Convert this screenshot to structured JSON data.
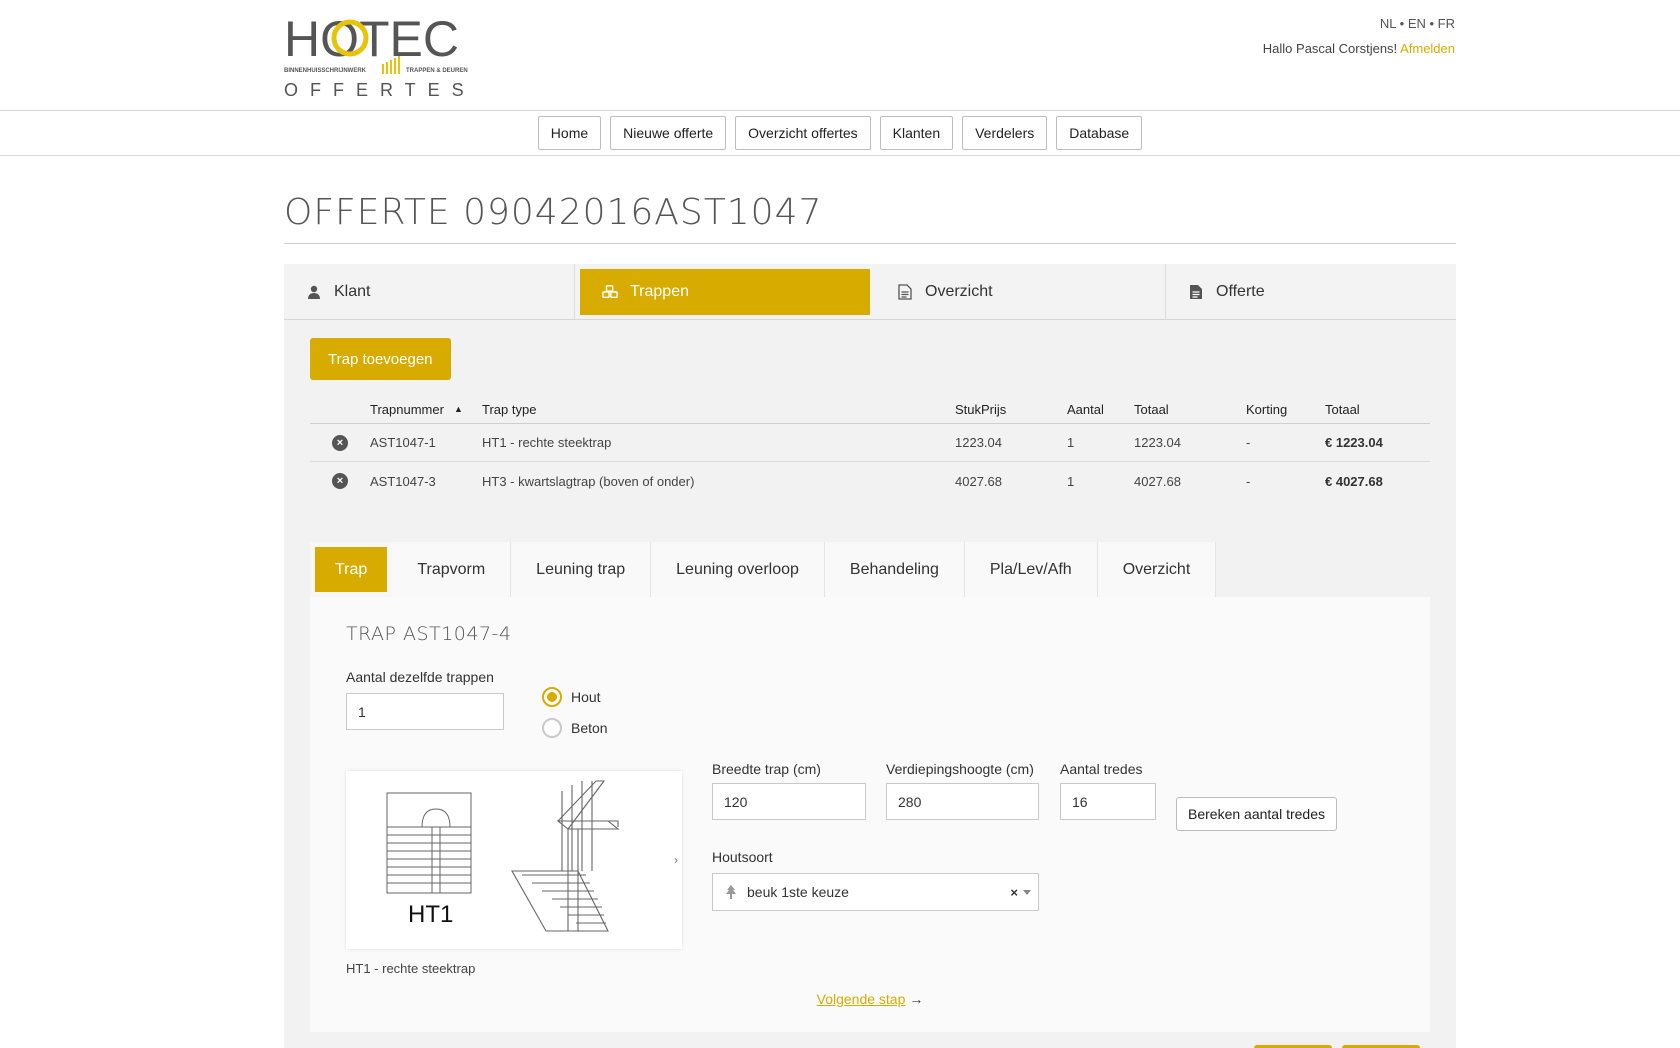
{
  "brand": {
    "logo_main": "HOTEC",
    "logo_left_small": "BINNENHUISSCHRIJNWERK",
    "logo_right_small": "TRAPPEN & DEUREN",
    "logo_sub": "OFFERTES"
  },
  "header": {
    "languages": [
      "NL",
      "EN",
      "FR"
    ],
    "greeting": "Hallo Pascal Corstjens!",
    "logout": "Afmelden"
  },
  "nav": [
    "Home",
    "Nieuwe offerte",
    "Overzicht offertes",
    "Klanten",
    "Verdelers",
    "Database"
  ],
  "page": {
    "title": "OFFERTE 09042016AST1047"
  },
  "steps": [
    {
      "label": "Klant",
      "icon": "user-icon"
    },
    {
      "label": "Trappen",
      "icon": "cubes-icon"
    },
    {
      "label": "Overzicht",
      "icon": "document-icon"
    },
    {
      "label": "Offerte",
      "icon": "file-icon"
    }
  ],
  "add_button": "Trap toevoegen",
  "table": {
    "headers": [
      "Trapnummer",
      "Trap type",
      "StukPrijs",
      "Aantal",
      "Totaal",
      "Korting",
      "Totaal"
    ],
    "rows": [
      {
        "nr": "AST1047-1",
        "type": "HT1 - rechte steektrap",
        "price": "1223.04",
        "qty": "1",
        "total": "1223.04",
        "discount": "-",
        "grand": "€ 1223.04"
      },
      {
        "nr": "AST1047-3",
        "type": "HT3 - kwartslagtrap (boven of onder)",
        "price": "4027.68",
        "qty": "1",
        "total": "4027.68",
        "discount": "-",
        "grand": "€ 4027.68"
      }
    ]
  },
  "subtabs": [
    "Trap",
    "Trapvorm",
    "Leuning trap",
    "Leuning overloop",
    "Behandeling",
    "Pla/Lev/Afh",
    "Overzicht"
  ],
  "form": {
    "title": "TRAP AST1047-4",
    "count_label": "Aantal dezelfde trappen",
    "count_value": "1",
    "material_options": [
      "Hout",
      "Beton"
    ],
    "material_selected": "Hout",
    "preview_code": "HT1",
    "preview_caption": "HT1 - rechte steektrap",
    "width_label": "Breedte trap (cm)",
    "width_value": "120",
    "height_label": "Verdiepingshoogte (cm)",
    "height_value": "280",
    "steps_label": "Aantal tredes",
    "steps_value": "16",
    "calc_button": "Bereken aantal tredes",
    "wood_label": "Houtsoort",
    "wood_value": "beuk 1ste keuze",
    "wood_clear": "×",
    "next_link": "Volgende stap",
    "next_arrow": "→"
  },
  "colors": {
    "accent": "#d7ab00",
    "panel": "#f2f2f2"
  }
}
